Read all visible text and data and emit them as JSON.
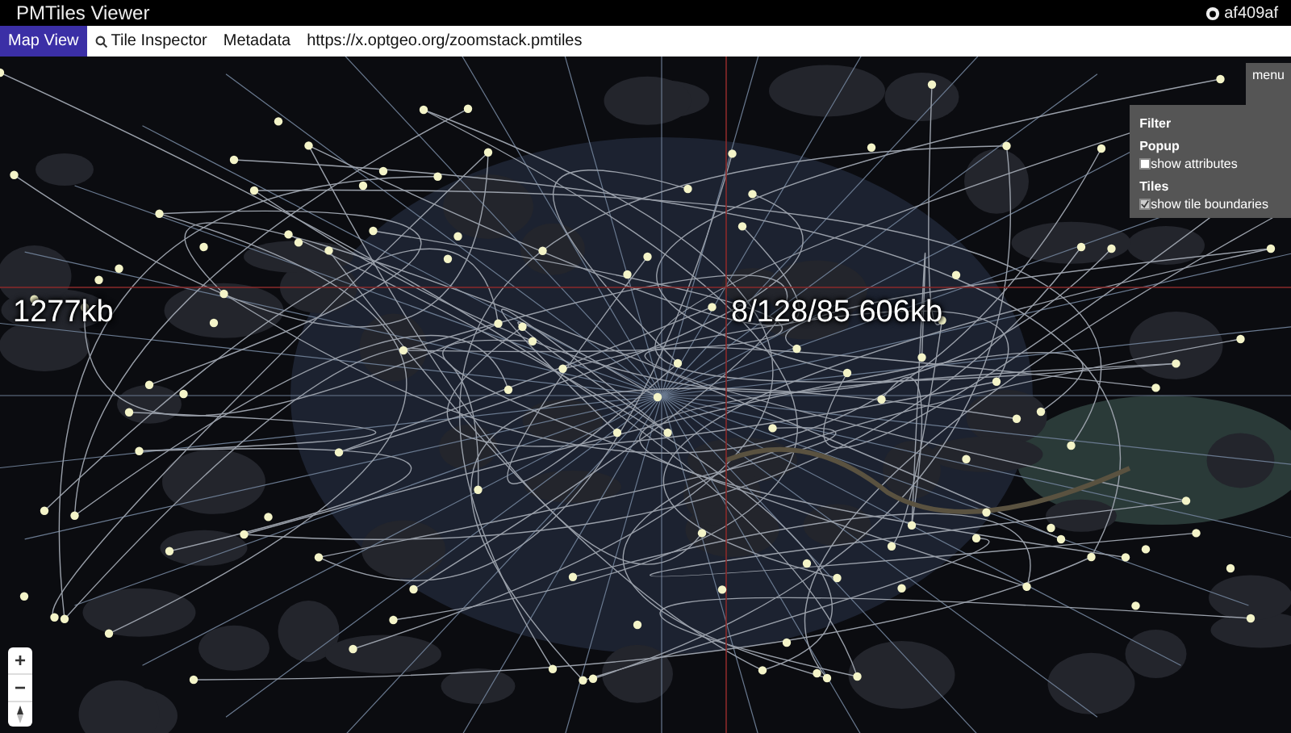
{
  "header": {
    "title": "PMTiles Viewer",
    "user": "af409af"
  },
  "tabs": [
    {
      "label": "Map View",
      "selected": true,
      "kind": "tab"
    },
    {
      "label": "Tile Inspector",
      "selected": false,
      "kind": "tab-icon"
    },
    {
      "label": "Metadata",
      "selected": false,
      "kind": "tab"
    }
  ],
  "url": "https://x.optgeo.org/zoomstack.pmtiles",
  "tile_labels": [
    {
      "text": "1277kb"
    },
    {
      "text": "8/128/85 606kb"
    }
  ],
  "menu": {
    "button": "menu",
    "sections": [
      {
        "title": "Filter"
      },
      {
        "title": "Popup",
        "options": [
          {
            "label": "show attributes",
            "checked": false
          }
        ]
      },
      {
        "title": "Tiles",
        "options": [
          {
            "label": "show tile boundaries",
            "checked": true
          }
        ]
      }
    ]
  },
  "zoom_controls": {
    "zoom_in": "+",
    "zoom_out": "−"
  }
}
